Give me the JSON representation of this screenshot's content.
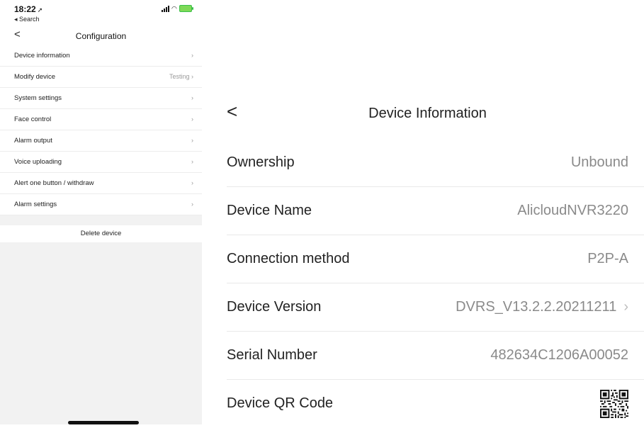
{
  "status_bar": {
    "time": "18:22",
    "location_icon": "location-arrow-icon",
    "back_app_label": "◂ Search"
  },
  "left": {
    "nav_title": "Configuration",
    "menu": [
      {
        "label": "Device information",
        "value": "",
        "chevron": "›"
      },
      {
        "label": "Modify device",
        "value": "Testing",
        "chevron": "›"
      },
      {
        "label": "System settings",
        "value": "",
        "chevron": "›"
      },
      {
        "label": "Face control",
        "value": "",
        "chevron": "›"
      },
      {
        "label": "Alarm output",
        "value": "",
        "chevron": "›"
      },
      {
        "label": "Voice uploading",
        "value": "",
        "chevron": "›"
      },
      {
        "label": "Alert one button / withdraw",
        "value": "",
        "chevron": "›"
      },
      {
        "label": "Alarm settings",
        "value": "",
        "chevron": "›"
      }
    ],
    "delete_label": "Delete device"
  },
  "right": {
    "title": "Device Information",
    "rows": [
      {
        "label": "Ownership",
        "value": "Unbound"
      },
      {
        "label": "Device Name",
        "value": "AlicloudNVR3220"
      },
      {
        "label": "Connection method",
        "value": "P2P-A"
      },
      {
        "label": "Device Version",
        "value": "DVRS_V13.2.2.20211211",
        "chevron": "›"
      },
      {
        "label": "Serial Number",
        "value": "482634C1206A00052"
      },
      {
        "label": "Device QR Code",
        "value": ""
      }
    ]
  },
  "colors": {
    "battery": "#7ed957",
    "secondary_text": "#8a8a8a",
    "background_gray": "#f2f2f2"
  }
}
